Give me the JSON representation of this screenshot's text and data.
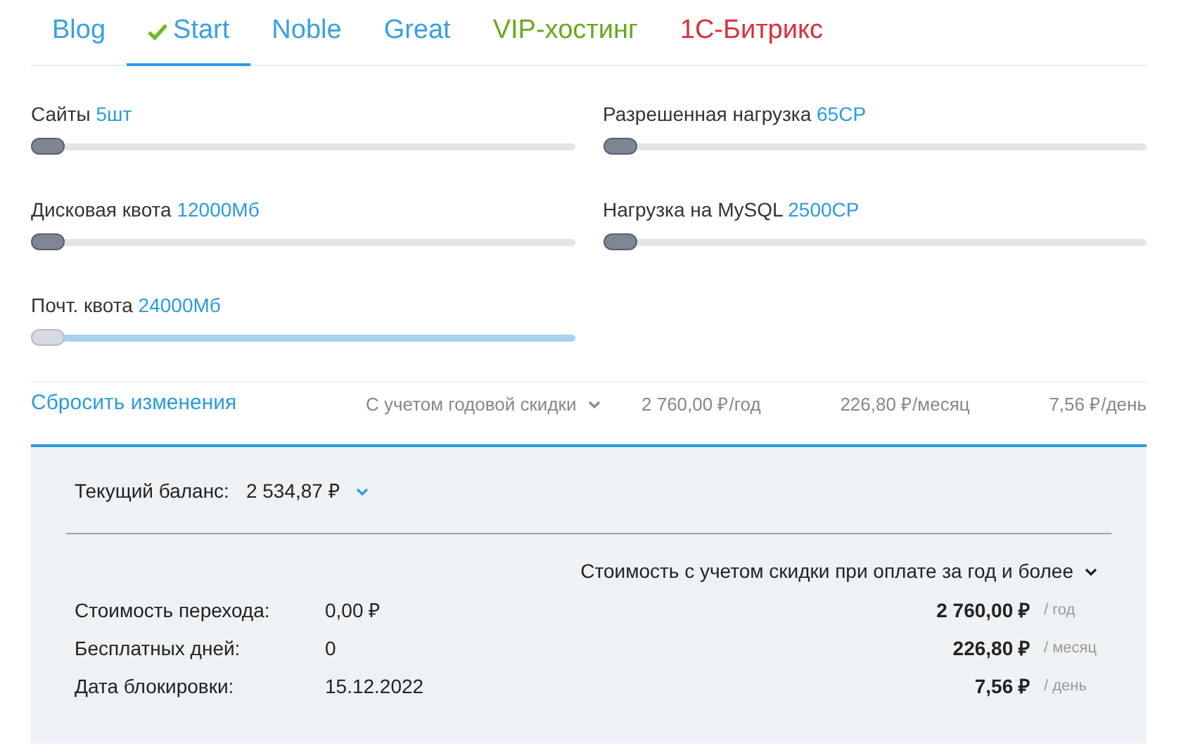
{
  "tabs": [
    {
      "label": "Blog",
      "selected": false,
      "color": "#3aa0e0"
    },
    {
      "label": "Start",
      "selected": true,
      "color": "#3aa0e0"
    },
    {
      "label": "Noble",
      "selected": false,
      "color": "#3aa0e0"
    },
    {
      "label": "Great",
      "selected": false,
      "color": "#3aa0e0"
    },
    {
      "label": "VIP-хостинг",
      "selected": false,
      "color": "#6aa81e"
    },
    {
      "label": "1С-Битрикс",
      "selected": false,
      "color": "#d9303a"
    }
  ],
  "sliders": [
    {
      "label": "Сайты",
      "value": "5шт",
      "level": 0,
      "highlighted": false
    },
    {
      "label": "Разрешенная нагрузка",
      "value": "65CP",
      "level": 0,
      "highlighted": false
    },
    {
      "label": "Дисковая квота",
      "value": "12000Мб",
      "level": 0,
      "highlighted": false
    },
    {
      "label": "Нагрузка на MySQL",
      "value": "2500CP",
      "level": 0,
      "highlighted": false
    },
    {
      "label": "Почт. квота",
      "value": "24000Мб",
      "level": 0,
      "highlighted": true
    }
  ],
  "summary": {
    "reset_link": "Сбросить изменения",
    "discount_select": "С учетом годовой скидки",
    "prices": [
      "2 760,00 ₽/год",
      "226,80 ₽/месяц",
      "7,56 ₽/день"
    ]
  },
  "balance_panel": {
    "balance_label": "Текущий баланс:",
    "balance_value": "2 534,87 ₽",
    "cost_select": "Стоимость с учетом скидки при оплате за год и более",
    "rows": [
      {
        "label": "Стоимость перехода:",
        "value": "0,00 ₽",
        "price": "2 760,00 ₽",
        "period": "/ год"
      },
      {
        "label": "Бесплатных дней:",
        "value": "0",
        "price": "226,80 ₽",
        "period": "/ месяц"
      },
      {
        "label": "Дата блокировки:",
        "value": "15.12.2022",
        "price": "7,56 ₽",
        "period": "/ день"
      }
    ]
  }
}
